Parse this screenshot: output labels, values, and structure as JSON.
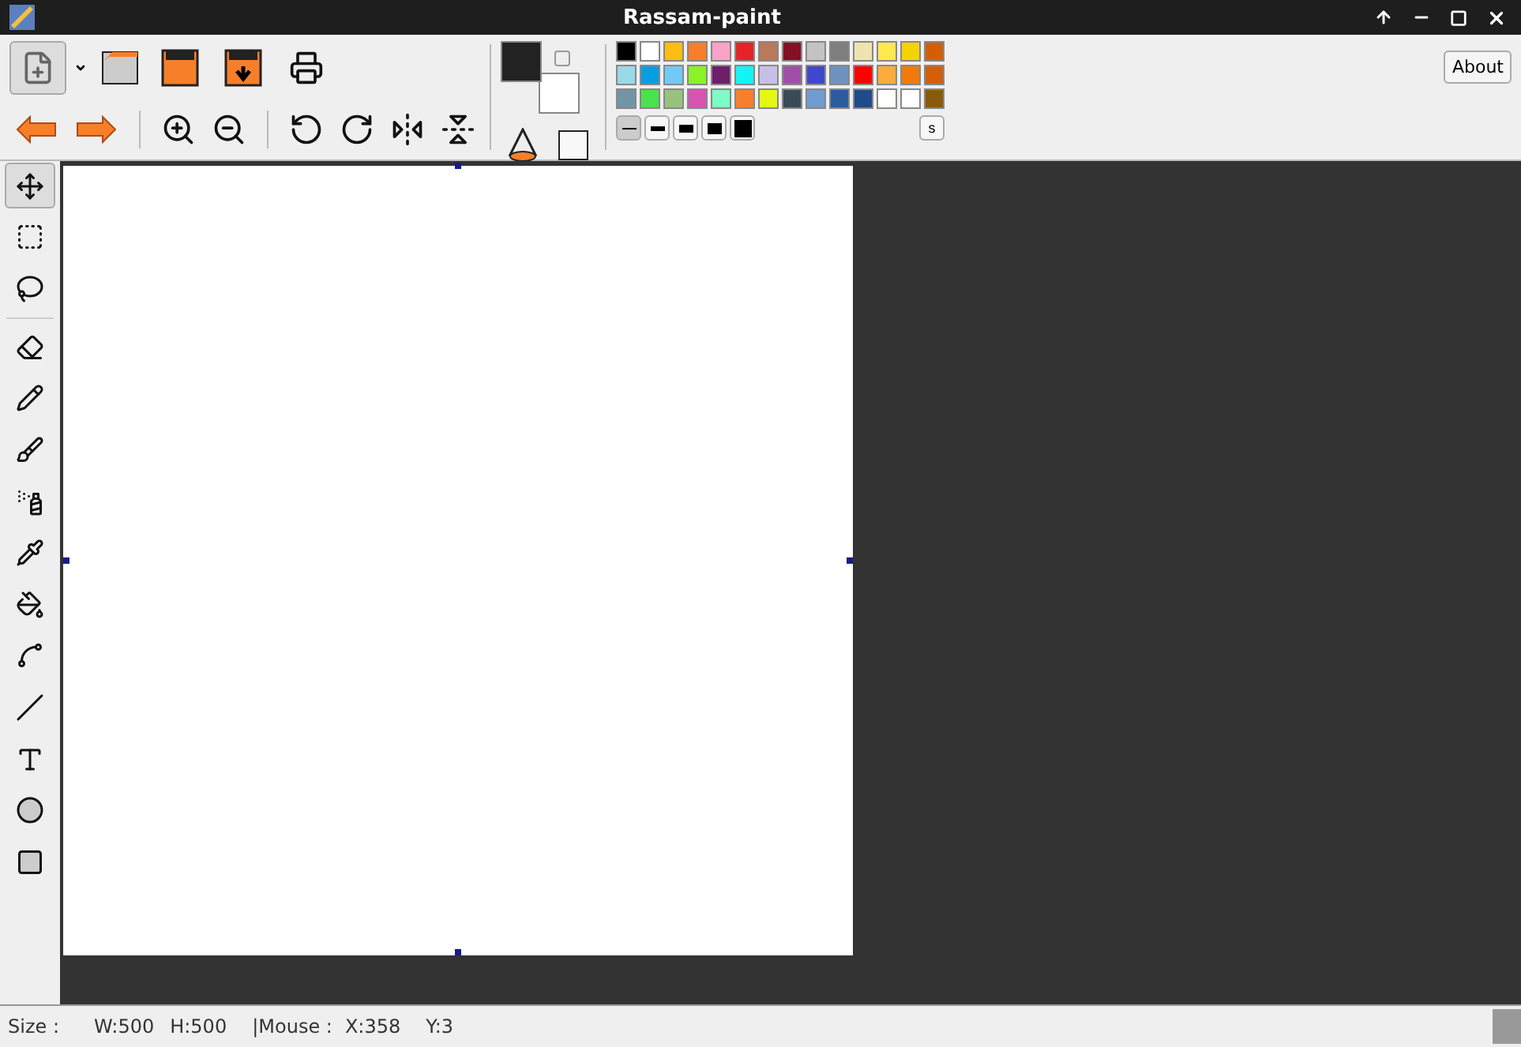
{
  "window": {
    "title": "Rassam-paint"
  },
  "current_colors": [
    {
      "kind": "foreground",
      "color": "#222222"
    },
    {
      "kind": "background",
      "color": "#ffffff"
    }
  ],
  "palette": [
    {
      "color": "#000000"
    },
    {
      "color": "#ffffff"
    },
    {
      "color": "#fbbd12"
    },
    {
      "color": "#f77f2a"
    },
    {
      "color": "#f9a3c8"
    },
    {
      "color": "#e52329"
    },
    {
      "color": "#b87a5a"
    },
    {
      "color": "#870f25"
    },
    {
      "color": "#c3c3c3"
    },
    {
      "color": "#7f7f7f"
    },
    {
      "color": "#efe4b0"
    },
    {
      "color": "#fde84e"
    },
    {
      "color": "#f4d300"
    },
    {
      "color": "#d35f05"
    },
    {
      "color": "#99d9ea"
    },
    {
      "color": "#079de2"
    },
    {
      "color": "#73c8f6"
    },
    {
      "color": "#8bf129"
    },
    {
      "color": "#6e1e6b"
    },
    {
      "color": "#12f4f6"
    },
    {
      "color": "#c8bfe7"
    },
    {
      "color": "#a04fa8"
    },
    {
      "color": "#3f48cc"
    },
    {
      "color": "#7092be"
    },
    {
      "color": "#ff0000"
    },
    {
      "color": "#fbac3a"
    },
    {
      "color": "#f37a0a"
    },
    {
      "color": "#d35f06"
    },
    {
      "color": "#7295a6"
    },
    {
      "color": "#4ce14e"
    },
    {
      "color": "#99c27e"
    },
    {
      "color": "#d653b1"
    },
    {
      "color": "#7dfdc6"
    },
    {
      "color": "#f77f2b"
    },
    {
      "color": "#e4f816"
    },
    {
      "color": "#394b57"
    },
    {
      "color": "#6f9bd1"
    },
    {
      "color": "#2a5c9f"
    },
    {
      "color": "#1f4a8c"
    },
    {
      "color": "#fffffe"
    },
    {
      "color": "#fefefe"
    },
    {
      "color": "#8a5a0c"
    }
  ],
  "line_widths": [
    {
      "selected": true
    },
    {
      "selected": false
    },
    {
      "selected": false
    },
    {
      "selected": false
    },
    {
      "selected": false
    }
  ],
  "palette_button": "s",
  "about_button": "About",
  "tools": [
    {
      "kind": "move",
      "selected": true
    },
    {
      "kind": "rect-select",
      "selected": false
    },
    {
      "kind": "free-select",
      "selected": false
    },
    {
      "kind": "eraser",
      "selected": false
    },
    {
      "kind": "pencil",
      "selected": false
    },
    {
      "kind": "brush",
      "selected": false
    },
    {
      "kind": "spray",
      "selected": false
    },
    {
      "kind": "picker",
      "selected": false
    },
    {
      "kind": "fill",
      "selected": false
    },
    {
      "kind": "curve",
      "selected": false
    },
    {
      "kind": "line",
      "selected": false
    },
    {
      "kind": "text",
      "selected": false
    },
    {
      "kind": "ellipse",
      "selected": false
    },
    {
      "kind": "rectangle",
      "selected": false
    }
  ],
  "status_bar": {
    "size_label": "Size :",
    "width": "W:500",
    "height": "H:500",
    "mouse_label": "|Mouse :",
    "x": "X:358",
    "y": "Y:3"
  }
}
